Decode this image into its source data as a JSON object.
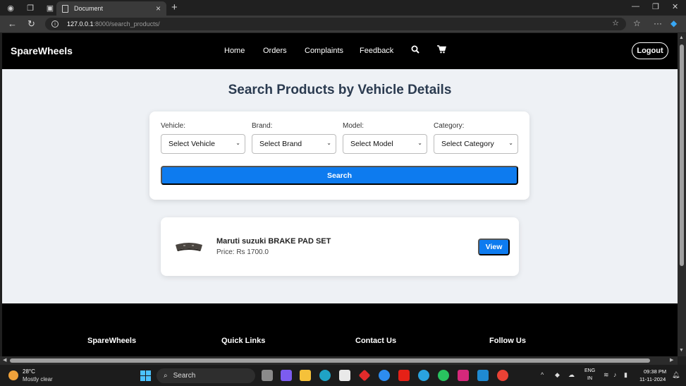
{
  "browser": {
    "tab_title": "Document",
    "url_host": "127.0.0.1",
    "url_rest": ":8000/search_products/"
  },
  "navbar": {
    "brand": "SpareWheels",
    "links": [
      "Home",
      "Orders",
      "Complaints",
      "Feedback"
    ],
    "icons": [
      "search-icon",
      "cart-icon"
    ],
    "logout": "Logout"
  },
  "main": {
    "title": "Search Products by Vehicle Details",
    "filters": [
      {
        "label": "Vehicle:",
        "selected": "Select Vehicle"
      },
      {
        "label": "Brand:",
        "selected": "Select Brand"
      },
      {
        "label": "Model:",
        "selected": "Select Model"
      },
      {
        "label": "Category:",
        "selected": "Select Category"
      }
    ],
    "search_button": "Search",
    "products": [
      {
        "name": "Maruti suzuki BRAKE PAD SET",
        "price": "Price: Rs 1700.0",
        "view": "View"
      }
    ]
  },
  "footer": {
    "columns": [
      "SpareWheels",
      "Quick Links",
      "Contact Us",
      "Follow Us"
    ]
  },
  "taskbar": {
    "weather_temp": "28°C",
    "weather_desc": "Mostly clear",
    "search_label": "Search",
    "lang": "ENG",
    "region": "IN",
    "time": "09:38 PM",
    "date": "11-11-2024"
  },
  "colors": {
    "accent": "#0d7bef",
    "navbar": "#000000",
    "page_bg": "#eef1f5",
    "heading": "#2b3b50"
  }
}
